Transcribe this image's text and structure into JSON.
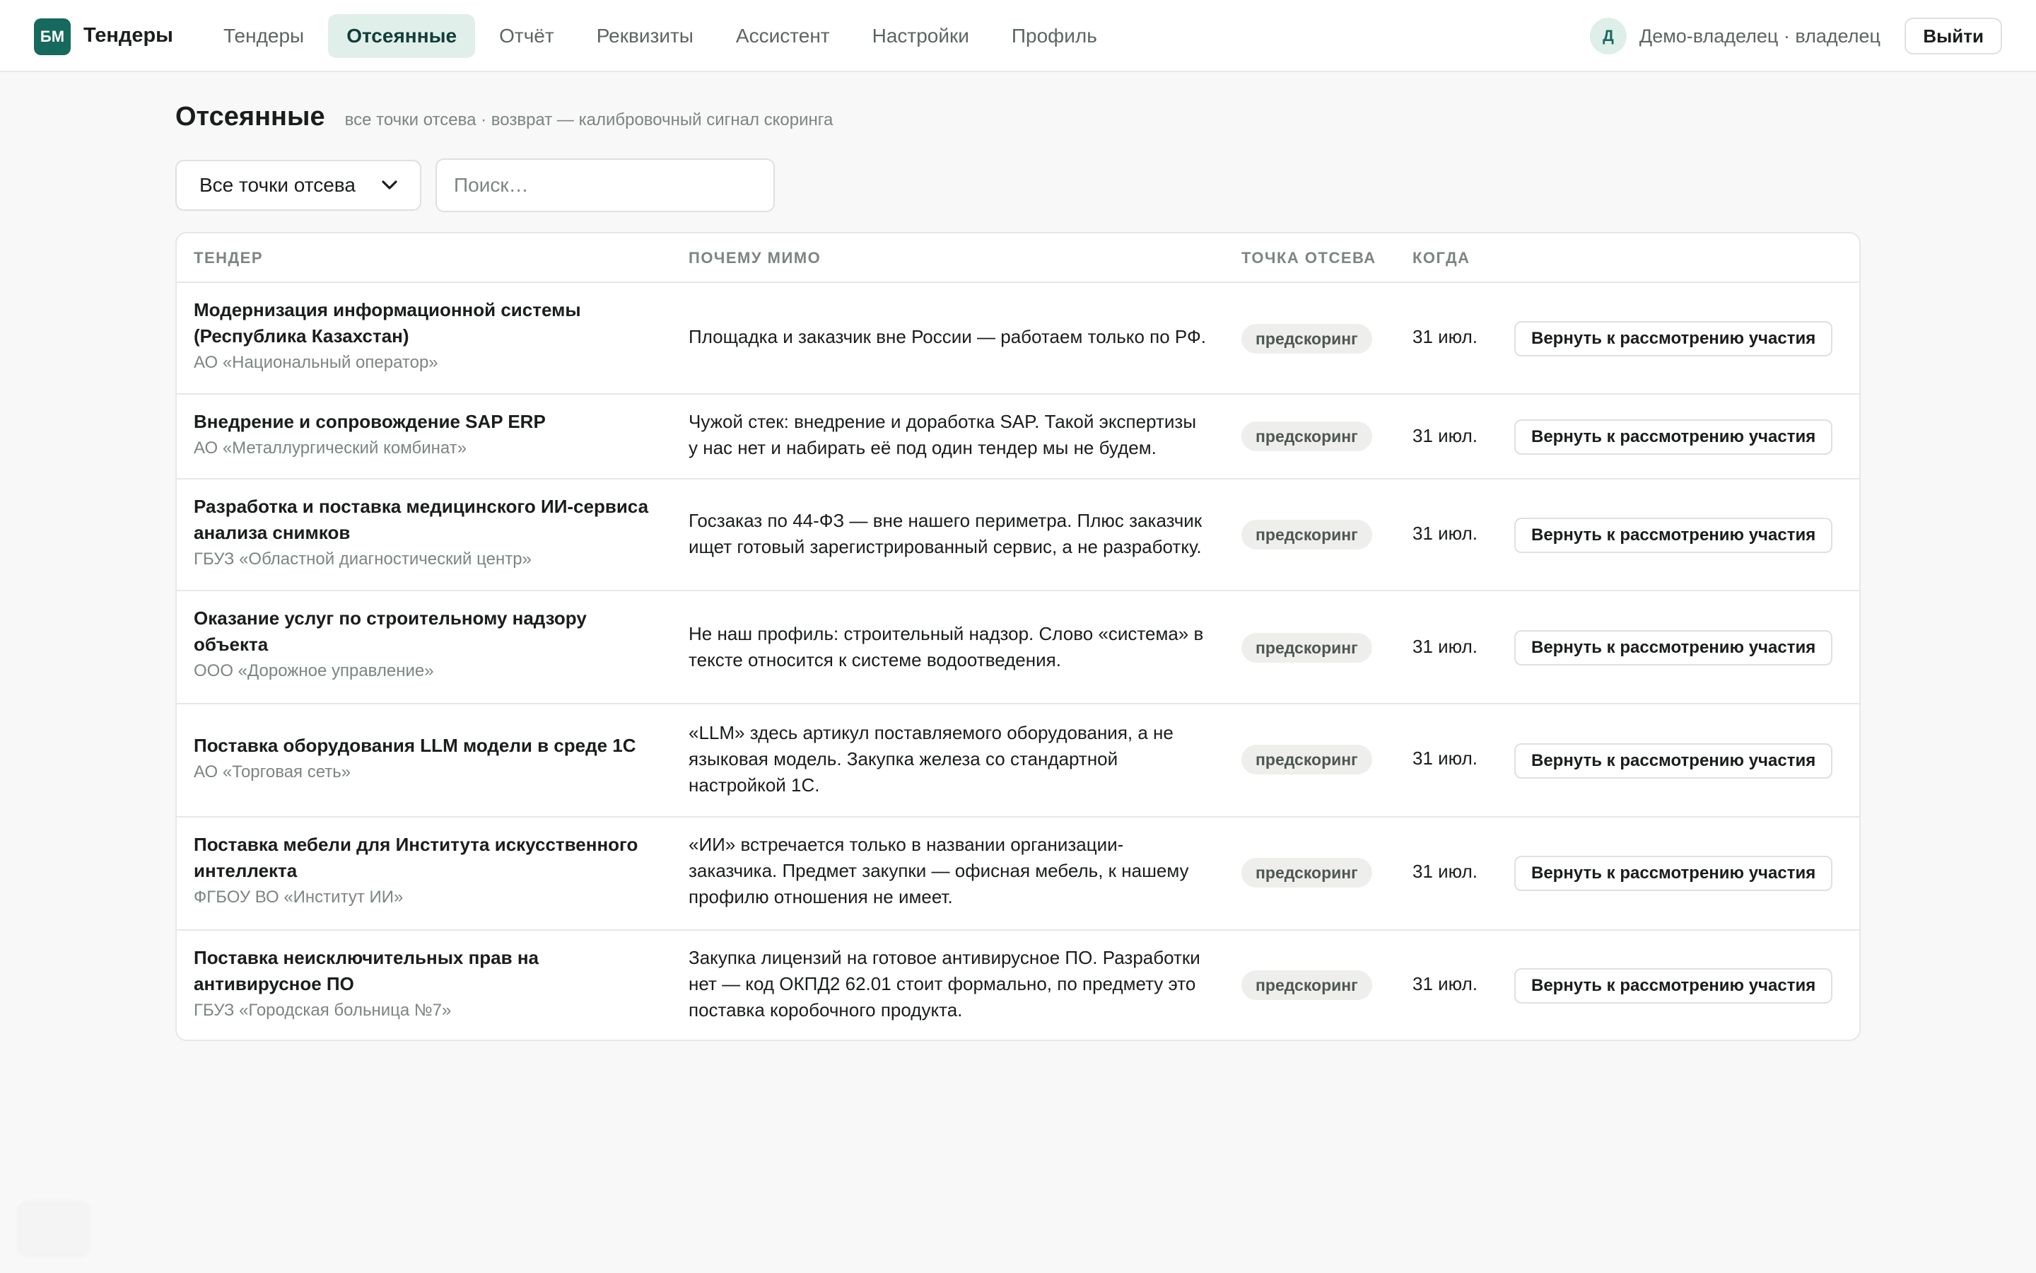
{
  "app": {
    "logo_text": "БМ",
    "title": "Тендеры"
  },
  "nav": {
    "items": [
      {
        "label": "Тендеры",
        "active": false
      },
      {
        "label": "Отсеянные",
        "active": true
      },
      {
        "label": "Отчёт",
        "active": false
      },
      {
        "label": "Реквизиты",
        "active": false
      },
      {
        "label": "Ассистент",
        "active": false
      },
      {
        "label": "Настройки",
        "active": false
      },
      {
        "label": "Профиль",
        "active": false
      }
    ]
  },
  "user": {
    "avatar_letter": "Д",
    "name": "Демо-владелец · владелец",
    "logout_label": "Выйти"
  },
  "page": {
    "title": "Отсеянные",
    "subtitle": "все точки отсева · возврат — калибровочный сигнал скоринга"
  },
  "filters": {
    "select_value": "Все точки отсева",
    "search_placeholder": "Поиск…"
  },
  "table": {
    "headers": {
      "tender": "ТЕНДЕР",
      "reason": "ПОЧЕМУ МИМО",
      "stage": "ТОЧКА ОТСЕВА",
      "when": "КОГДА"
    },
    "rows": [
      {
        "title_lines": [
          "Модернизация информационной системы",
          "(Республика Казахстан)"
        ],
        "org": "АО «Национальный оператор»",
        "reason_lines": [
          "Площадка и заказчик вне России — работаем только по РФ."
        ],
        "stage": "предскоринг",
        "date": "31 июл.",
        "action": "Вернуть к рассмотрению участия"
      },
      {
        "title_lines": [
          "Внедрение и сопровождение SAP ERP"
        ],
        "org": "АО «Металлургический комбинат»",
        "reason_lines": [
          "Чужой стек: внедрение и доработка SAP. Такой экспертизы",
          "у нас нет и набирать её под один тендер мы не будем."
        ],
        "stage": "предскоринг",
        "date": "31 июл.",
        "action": "Вернуть к рассмотрению участия"
      },
      {
        "title_lines": [
          "Разработка и поставка медицинского ИИ-сервиса",
          "анализа снимков"
        ],
        "org": "ГБУЗ «Областной диагностический центр»",
        "reason_lines": [
          "Госзаказ по 44-ФЗ — вне нашего периметра. Плюс заказчик",
          "ищет готовый зарегистрированный сервис, а не разработку."
        ],
        "stage": "предскоринг",
        "date": "31 июл.",
        "action": "Вернуть к рассмотрению участия"
      },
      {
        "title_lines": [
          "Оказание услуг по строительному надзору",
          "объекта"
        ],
        "org": "ООО «Дорожное управление»",
        "reason_lines": [
          "Не наш профиль: строительный надзор. Слово «система» в",
          "тексте относится к системе водоотведения."
        ],
        "stage": "предскоринг",
        "date": "31 июл.",
        "action": "Вернуть к рассмотрению участия"
      },
      {
        "title_lines": [
          "Поставка оборудования LLM модели в среде 1С"
        ],
        "org": "АО «Торговая сеть»",
        "reason_lines": [
          "«LLM» здесь артикул поставляемого оборудования, а не",
          "языковая модель. Закупка железа со стандартной",
          "настройкой 1С."
        ],
        "stage": "предскоринг",
        "date": "31 июл.",
        "action": "Вернуть к рассмотрению участия"
      },
      {
        "title_lines": [
          "Поставка мебели для Института искусственного",
          "интеллекта"
        ],
        "org": "ФГБОУ ВО «Институт ИИ»",
        "reason_lines": [
          "«ИИ» встречается только в названии организации-",
          "заказчика. Предмет закупки — офисная мебель, к нашему",
          "профилю отношения не имеет."
        ],
        "stage": "предскоринг",
        "date": "31 июл.",
        "action": "Вернуть к рассмотрению участия"
      },
      {
        "title_lines": [
          "Поставка неисключительных прав на",
          "антивирусное ПО"
        ],
        "org": "ГБУЗ «Городская больница №7»",
        "reason_lines": [
          "Закупка лицензий на готовое антивирусное ПО. Разработки",
          "нет — код ОКПД2 62.01 стоит формально, по предмету это",
          "поставка коробочного продукта."
        ],
        "stage": "предскоринг",
        "date": "31 июл.",
        "action": "Вернуть к рассмотрению участия"
      }
    ]
  },
  "colors": {
    "brand": "#16695d",
    "nav_active_bg": "#e1efeb",
    "badge_bg": "#eeeeec"
  }
}
